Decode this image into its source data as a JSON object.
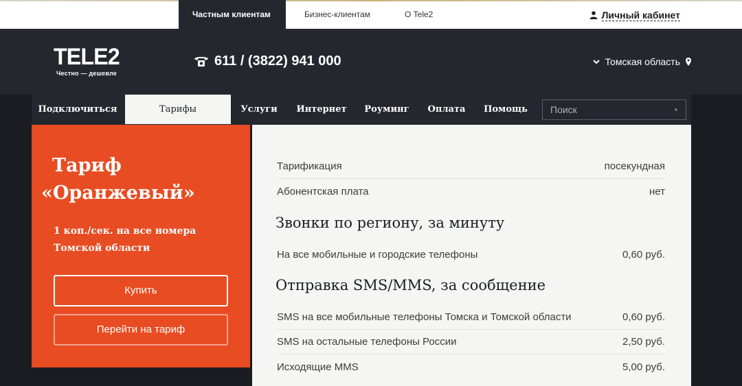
{
  "top_tabs": [
    {
      "label": "Частным клиентам",
      "active": true
    },
    {
      "label": "Бизнес-клиентам",
      "active": false
    },
    {
      "label": "О Tele2",
      "active": false
    }
  ],
  "cabinet": {
    "label": "Личный кабинет",
    "icon": "user-icon"
  },
  "header": {
    "logo_text": "TELE2",
    "slogan": "Честно — дешевле",
    "phone": "611 / (3822) 941 000",
    "phone_icon": "phone-icon",
    "region": "Томская область",
    "region_icons": [
      "chevron-down-icon",
      "location-pin-icon"
    ]
  },
  "nav": {
    "items": [
      {
        "label": "Подключиться",
        "active": false
      },
      {
        "label": "Тарифы",
        "active": true
      },
      {
        "label": "Услуги",
        "active": false
      },
      {
        "label": "Интернет",
        "active": false
      },
      {
        "label": "Роуминг",
        "active": false
      },
      {
        "label": "Оплата",
        "active": false
      },
      {
        "label": "Помощь",
        "active": false
      }
    ],
    "search_placeholder": "Поиск",
    "search_icon": "search-icon"
  },
  "tariff": {
    "title_line1": "Тариф",
    "title_line2": "«Оранжевый»",
    "desc_line1": "1 коп./сек. на все номера",
    "desc_line2": "Томской области",
    "buy_label": "Купить",
    "switch_label": "Перейти на тариф",
    "color": "#e84c22"
  },
  "details": {
    "general": [
      {
        "label": "Тарификация",
        "value": "посекундная"
      },
      {
        "label": "Абонентская плата",
        "value": "нет"
      }
    ],
    "calls_title": "Звонки по региону, за минуту",
    "calls": [
      {
        "label": "На все мобильные и городские телефоны",
        "value": "0,60 руб."
      }
    ],
    "sms_title": "Отправка SMS/MMS, за сообщение",
    "sms": [
      {
        "label": "SMS на все мобильные телефоны Томска и Томской области",
        "value": "0,60 руб."
      },
      {
        "label": "SMS на остальные телефоны России",
        "value": "2,50 руб."
      },
      {
        "label": "Исходящие MMS",
        "value": "5,00 руб."
      }
    ]
  }
}
